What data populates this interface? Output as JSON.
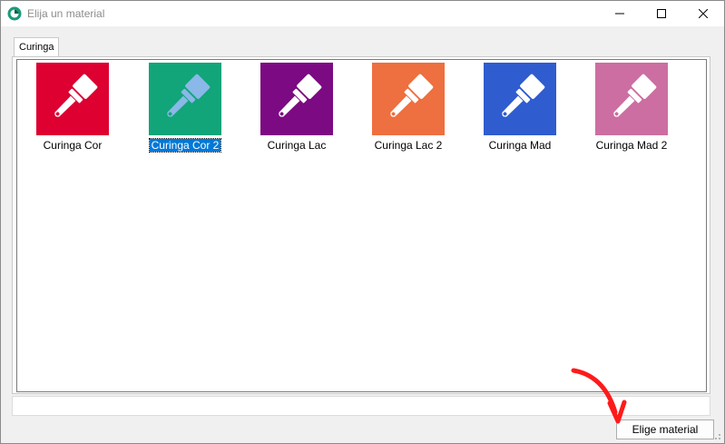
{
  "window": {
    "title": "Elija un material",
    "accent": "#1a9a7a"
  },
  "tabs": [
    {
      "label": "Curinga",
      "active": true
    }
  ],
  "materials": [
    {
      "name": "Curinga Cor",
      "color": "#dd0031",
      "icon": "paint-brush-icon",
      "selected": false
    },
    {
      "name": "Curinga Cor 2",
      "color": "#11a579",
      "icon": "paint-brush-icon",
      "selected": true
    },
    {
      "name": "Curinga Lac",
      "color": "#7c0a82",
      "icon": "paint-brush-icon",
      "selected": false
    },
    {
      "name": "Curinga Lac 2",
      "color": "#ee6f3f",
      "icon": "paint-brush-icon",
      "selected": false
    },
    {
      "name": "Curinga Mad",
      "color": "#2f5ccf",
      "icon": "paint-brush-icon",
      "selected": false
    },
    {
      "name": "Curinga Mad 2",
      "color": "#cc6ea1",
      "icon": "paint-brush-icon",
      "selected": false
    }
  ],
  "footer": {
    "confirm_label": "Elige material"
  },
  "annotation": {
    "arrow_color": "#ff1a1a"
  }
}
